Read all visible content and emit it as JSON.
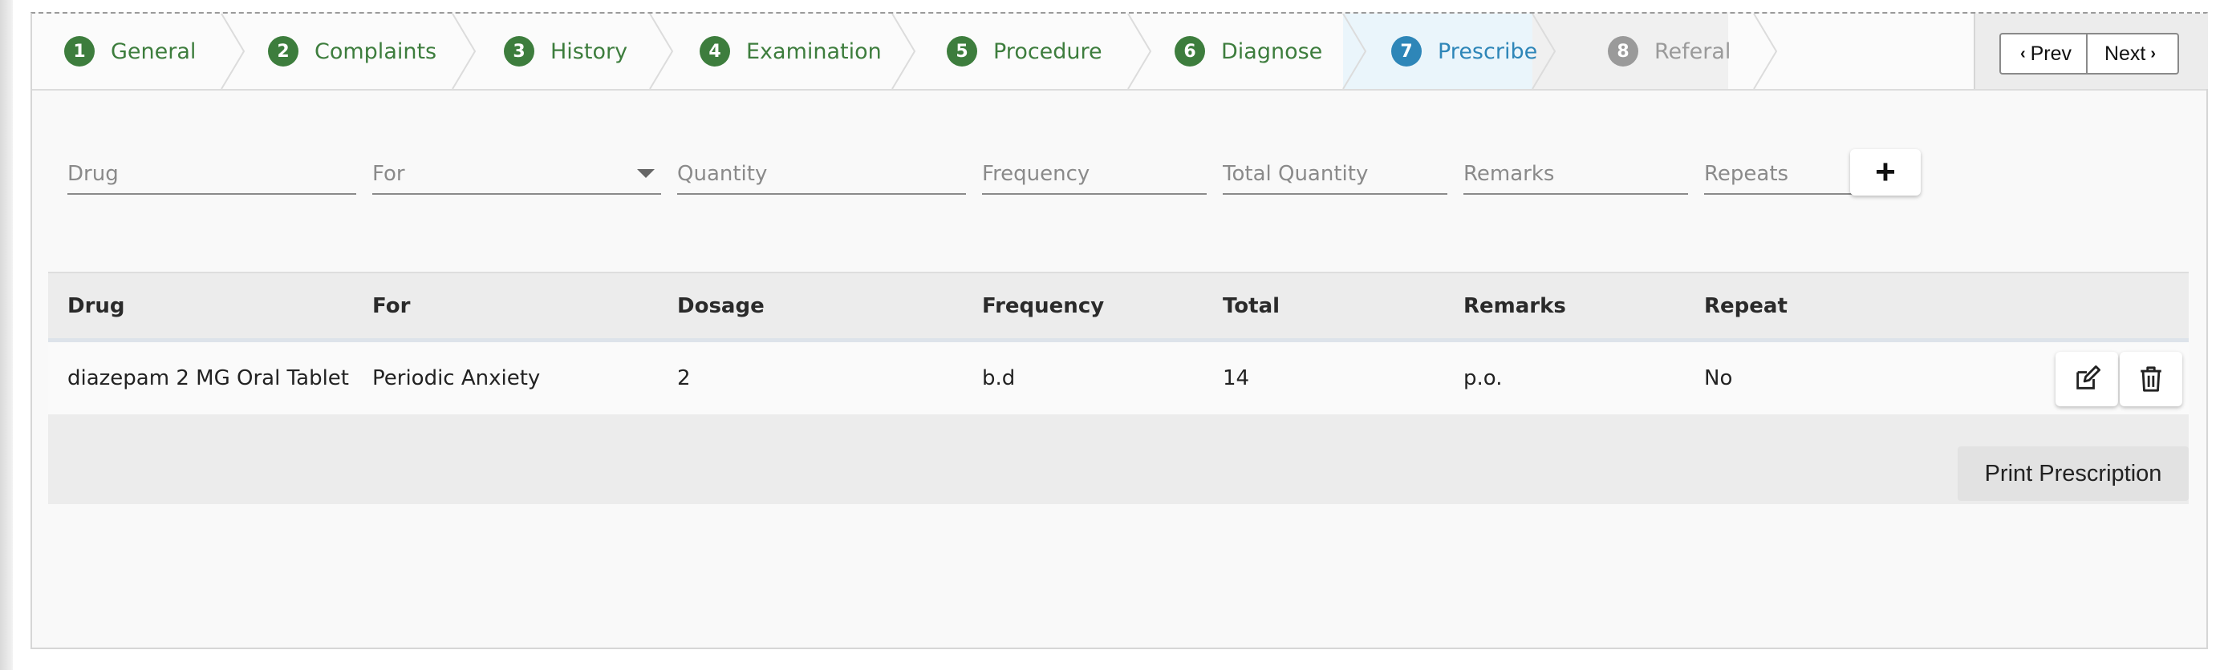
{
  "steps": [
    {
      "num": "1",
      "label": "General"
    },
    {
      "num": "2",
      "label": "Complaints"
    },
    {
      "num": "3",
      "label": "History"
    },
    {
      "num": "4",
      "label": "Examination"
    },
    {
      "num": "5",
      "label": "Procedure"
    },
    {
      "num": "6",
      "label": "Diagnose"
    },
    {
      "num": "7",
      "label": "Prescribe"
    },
    {
      "num": "8",
      "label": "Referal"
    }
  ],
  "active_step": "Prescribe",
  "nav": {
    "prev_label": "Prev",
    "next_label": "Next"
  },
  "form": {
    "drug_placeholder": "Drug",
    "for_placeholder": "For",
    "quantity_placeholder": "Quantity",
    "frequency_placeholder": "Frequency",
    "total_quantity_placeholder": "Total Quantity",
    "remarks_placeholder": "Remarks",
    "repeats_placeholder": "Repeats",
    "add_label": "+"
  },
  "table": {
    "headers": [
      "Drug",
      "For",
      "Dosage",
      "Frequency",
      "Total",
      "Remarks",
      "Repeat"
    ],
    "rows": [
      {
        "drug": "diazepam 2 MG Oral Tablet",
        "for": "Periodic Anxiety",
        "dosage": "2",
        "frequency": "b.d",
        "total": "14",
        "remarks": "p.o.",
        "repeat": "No"
      }
    ]
  },
  "print_label": "Print Prescription",
  "colors": {
    "complete": "#3d7d3d",
    "active": "#2e86b8",
    "disabled": "#9a9a9a"
  },
  "icons": [
    "edit-icon",
    "trash-icon",
    "chevron-left-icon",
    "chevron-right-icon",
    "caret-down-icon",
    "plus-icon"
  ]
}
